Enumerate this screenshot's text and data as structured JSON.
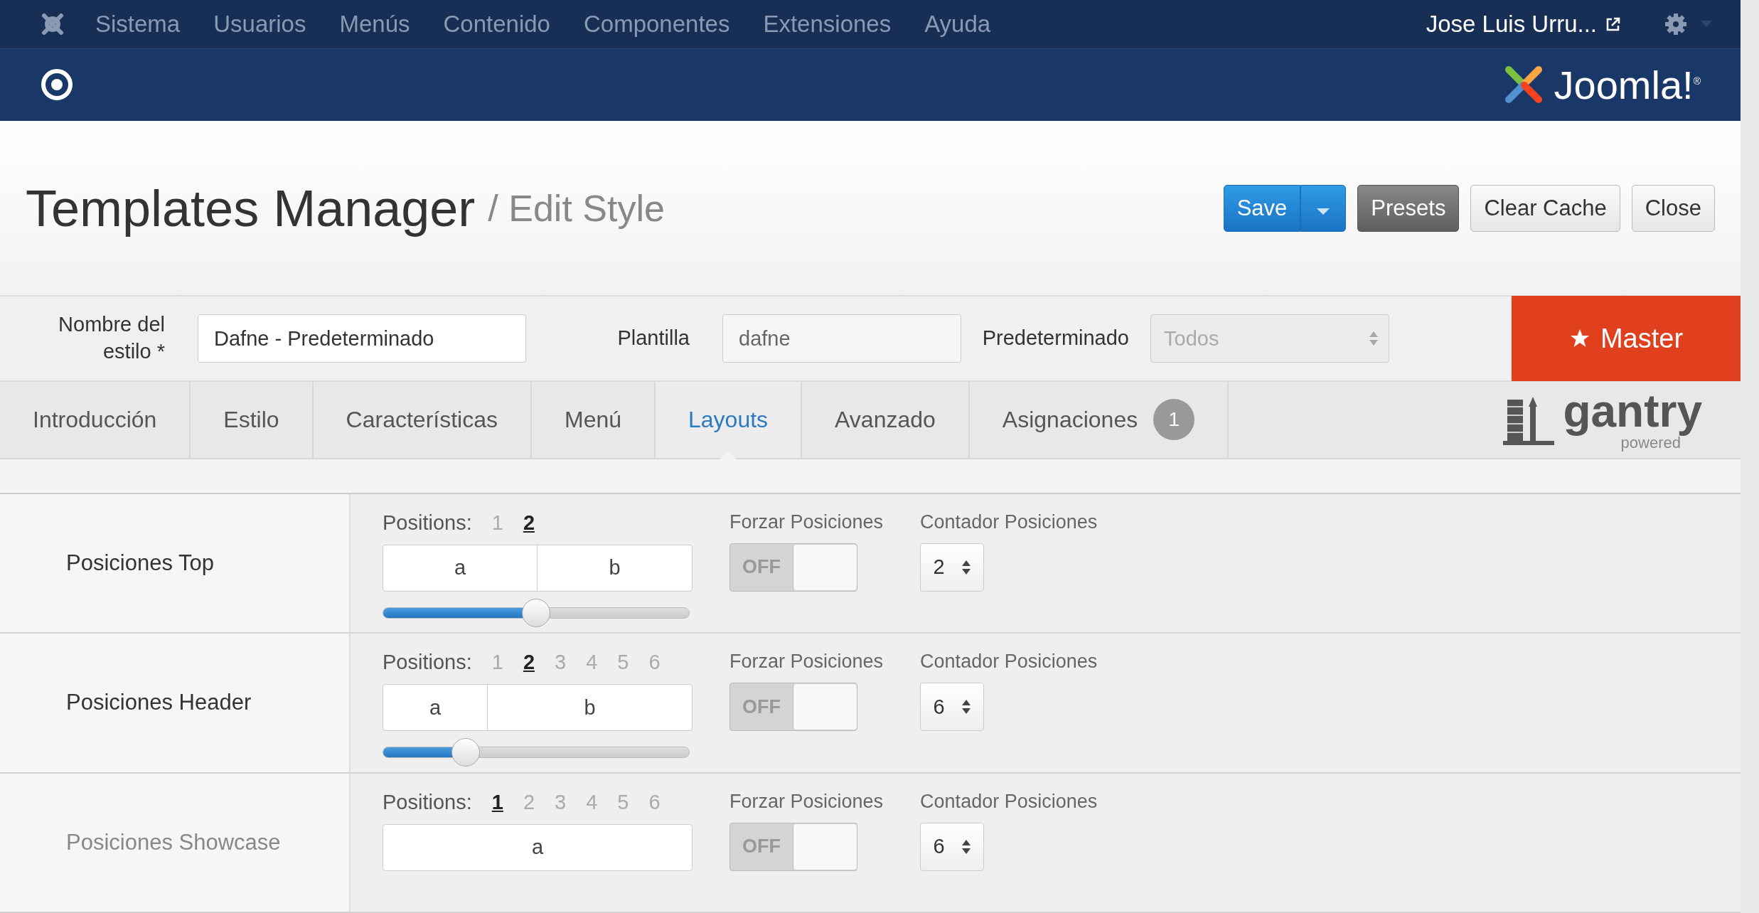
{
  "top_menu": {
    "items": [
      "Sistema",
      "Usuarios",
      "Menús",
      "Contenido",
      "Componentes",
      "Extensiones",
      "Ayuda"
    ],
    "user": "Jose Luis Urru..."
  },
  "header": {
    "logo_text": "Joomla!$^{®}$"
  },
  "page": {
    "title": "Templates Manager",
    "subtitle": "/ Edit Style"
  },
  "toolbar": {
    "save": "Save",
    "presets": "Presets",
    "clear_cache": "Clear Cache",
    "close": "Close"
  },
  "style_form": {
    "name_label": "Nombre del estilo *",
    "name_value": "Dafne - Predeterminado",
    "template_label": "Plantilla",
    "template_value": "dafne",
    "default_label": "Predeterminado",
    "default_value": "Todos",
    "master": "Master"
  },
  "tabs": [
    {
      "label": "Introducción",
      "selected": false
    },
    {
      "label": "Estilo",
      "selected": false
    },
    {
      "label": "Características",
      "selected": false
    },
    {
      "label": "Menú",
      "selected": false
    },
    {
      "label": "Layouts",
      "selected": true
    },
    {
      "label": "Avanzado",
      "selected": false
    },
    {
      "label": "Asignaciones",
      "selected": false,
      "badge": "1"
    }
  ],
  "gantry": {
    "name": "gantry",
    "tagline": "powered"
  },
  "layout_rows": [
    {
      "label": "Posiciones Top",
      "positions_label": "Positions:",
      "counts": [
        {
          "n": "1",
          "selected": false
        },
        {
          "n": "2",
          "selected": true
        }
      ],
      "cells": [
        "a",
        "b"
      ],
      "level": 0.5,
      "force_label": "Forzar Posiciones",
      "force": {
        "text": "OFF",
        "on": false
      },
      "counter_label": "Contador Posiciones",
      "counter": "2"
    },
    {
      "label": "Posiciones Header",
      "positions_label": "Positions:",
      "counts": [
        {
          "n": "1",
          "selected": false
        },
        {
          "n": "2",
          "selected": true
        },
        {
          "n": "3",
          "selected": false
        },
        {
          "n": "4",
          "selected": false
        },
        {
          "n": "5",
          "selected": false
        },
        {
          "n": "6",
          "selected": false
        }
      ],
      "cells": [
        "a",
        "b"
      ],
      "level": 0.27,
      "force_label": "Forzar Posiciones",
      "force": {
        "text": "OFF",
        "on": false
      },
      "counter_label": "Contador Posiciones",
      "counter": "6"
    },
    {
      "label": "Posiciones Showcase",
      "positions_label": "Positions:",
      "counts": [
        {
          "n": "1",
          "selected": true
        },
        {
          "n": "2",
          "selected": false
        },
        {
          "n": "3",
          "selected": false
        },
        {
          "n": "4",
          "selected": false
        },
        {
          "n": "5",
          "selected": false
        },
        {
          "n": "6",
          "selected": false
        }
      ],
      "cells": [
        "a"
      ],
      "force_label": "Forzar Posiciones",
      "force": {
        "text": "OFF",
        "on": false
      },
      "counter_label": "Contador Posiciones",
      "counter": "6"
    }
  ]
}
